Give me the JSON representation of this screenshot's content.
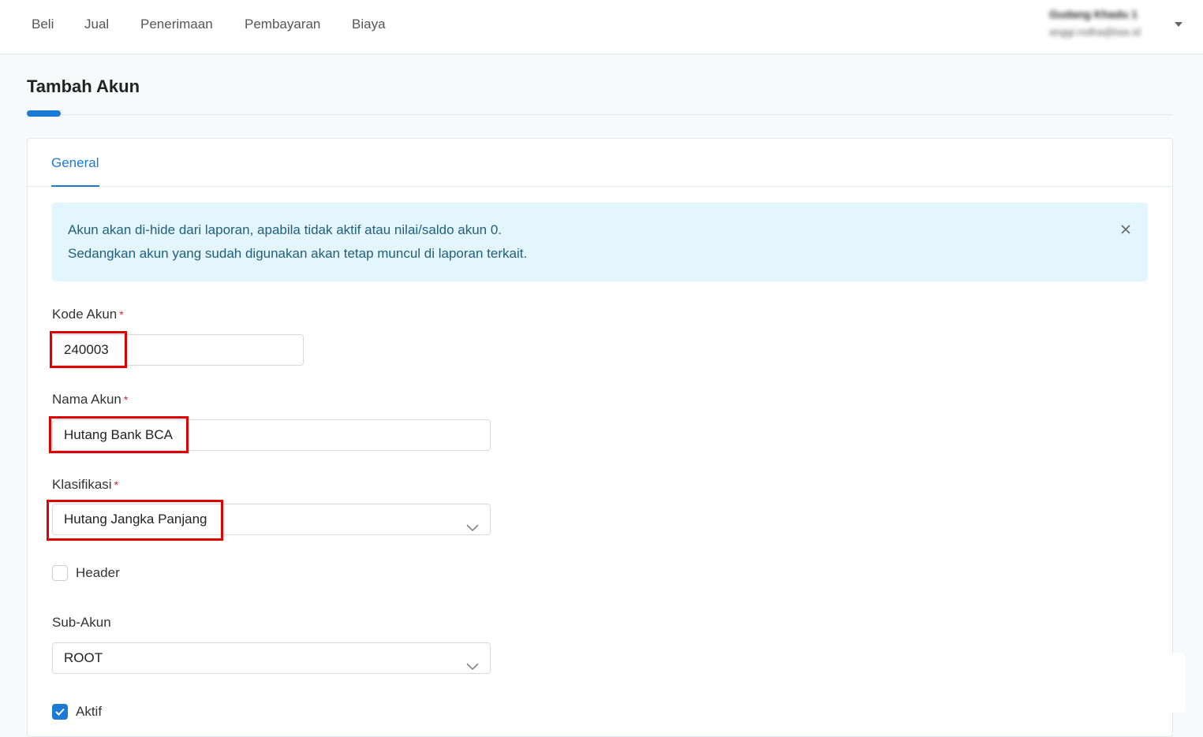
{
  "nav": {
    "items": [
      {
        "label": "Beli"
      },
      {
        "label": "Jual"
      },
      {
        "label": "Penerimaan"
      },
      {
        "label": "Pembayaran"
      },
      {
        "label": "Biaya"
      }
    ],
    "user": {
      "name": "Gudang Khadu 1",
      "email": "anggi.rodha@kas.id"
    }
  },
  "page": {
    "title": "Tambah Akun"
  },
  "tabs": [
    {
      "label": "General",
      "active": true
    }
  ],
  "alert": {
    "line1": "Akun akan di-hide dari laporan, apabila tidak aktif atau nilai/saldo akun 0.",
    "line2": "Sedangkan akun yang sudah digunakan akan tetap muncul di laporan terkait."
  },
  "form": {
    "kode_akun": {
      "label": "Kode Akun",
      "required": "*",
      "value": "240003"
    },
    "nama_akun": {
      "label": "Nama Akun",
      "required": "*",
      "value": "Hutang Bank BCA"
    },
    "klasifikasi": {
      "label": "Klasifikasi",
      "required": "*",
      "value": "Hutang Jangka Panjang"
    },
    "header": {
      "label": "Header",
      "checked": false
    },
    "sub_akun": {
      "label": "Sub-Akun",
      "value": "ROOT"
    },
    "aktif": {
      "label": "Aktif",
      "checked": true
    }
  },
  "colors": {
    "accent": "#1a7ad4",
    "alert_bg": "#e3f5fd",
    "highlight": "#e10000",
    "required": "#d9232d"
  },
  "icons": [
    "close-icon",
    "chevron-down-icon",
    "caret-down-icon",
    "check-icon"
  ]
}
